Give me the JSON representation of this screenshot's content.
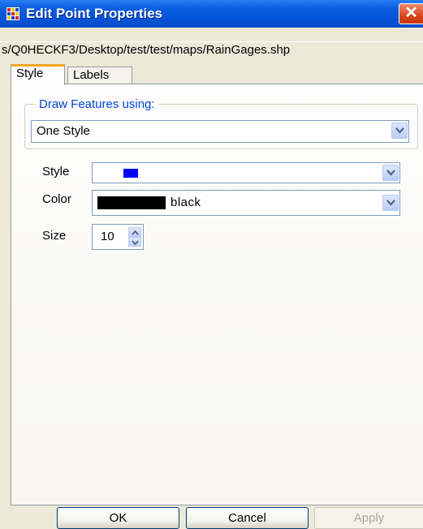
{
  "window": {
    "title": "Edit Point Properties",
    "close_symbol": "✕",
    "path": "s/Q0HECKF3/Desktop/test/test/maps/RainGages.shp"
  },
  "tabs": [
    {
      "label": "Style",
      "active": true
    },
    {
      "label": "Labels",
      "active": false
    }
  ],
  "draw_features": {
    "legend": "Draw Features using:",
    "selected": "One Style"
  },
  "fields": {
    "style_label": "Style",
    "style_swatch_color": "#0000ff",
    "color_label": "Color",
    "color_swatch": "#000000",
    "color_name": "black",
    "size_label": "Size",
    "size_value": "10"
  },
  "buttons": {
    "ok": "OK",
    "cancel": "Cancel",
    "apply": "Apply",
    "apply_enabled": false
  },
  "icons": [
    "app-grid-icon",
    "close-icon",
    "chevron-down-icon",
    "spin-up-icon",
    "spin-down-icon"
  ]
}
